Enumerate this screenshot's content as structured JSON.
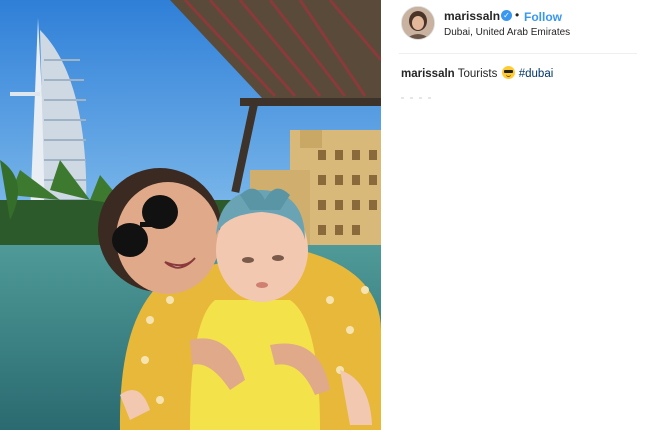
{
  "post": {
    "username": "marissaln",
    "follow_label": "Follow",
    "separator": "•",
    "location": "Dubai, United Arab Emirates",
    "verified": true
  },
  "caption": {
    "username": "marissaln",
    "text": "Tourists",
    "emoji": "smiling-face-with-sunglasses",
    "hashtag": "#dubai"
  },
  "colors": {
    "link_blue": "#3897f0",
    "hashtag_blue": "#003569",
    "text": "#262626"
  }
}
